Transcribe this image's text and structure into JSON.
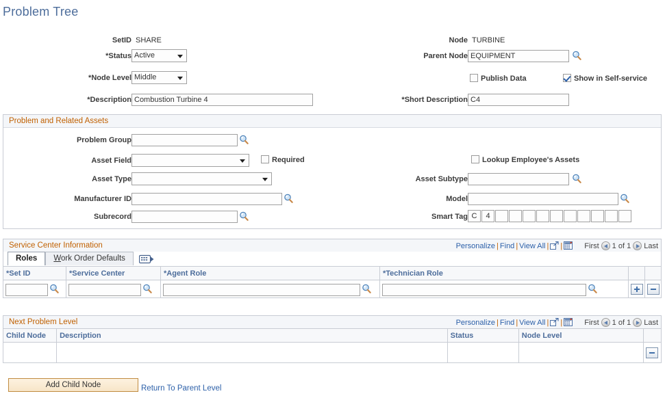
{
  "page": {
    "title": "Problem Tree"
  },
  "header_left": {
    "setid_label": "SetID",
    "setid_value": "SHARE",
    "status_label": "Status",
    "status_value": "Active",
    "node_level_label": "Node Level",
    "node_level_value": "Middle",
    "description_label": "Description",
    "description_value": "Combustion Turbine 4"
  },
  "header_right": {
    "node_label": "Node",
    "node_value": "TURBINE",
    "parent_node_label": "Parent Node",
    "parent_node_value": "EQUIPMENT",
    "publish_data_label": "Publish Data",
    "publish_data_checked": false,
    "show_self_service_label": "Show in Self-service",
    "show_self_service_checked": true,
    "short_description_label": "Short Description",
    "short_description_value": "C4"
  },
  "assets_section": {
    "title": "Problem and Related Assets",
    "problem_group_label": "Problem Group",
    "problem_group_value": "",
    "asset_field_label": "Asset Field",
    "asset_field_value": "",
    "required_label": "Required",
    "required_checked": false,
    "asset_type_label": "Asset Type",
    "asset_type_value": "",
    "manufacturer_id_label": "Manufacturer ID",
    "manufacturer_id_value": "",
    "subrecord_label": "Subrecord",
    "subrecord_value": "",
    "lookup_employee_assets_label": "Lookup Employee's Assets",
    "lookup_employee_assets_checked": false,
    "asset_subtype_label": "Asset Subtype",
    "asset_subtype_value": "",
    "model_label": "Model",
    "model_value": "",
    "smart_tag_label": "Smart Tag",
    "smart_tag_boxes": [
      "C",
      "4",
      "",
      "",
      "",
      "",
      "",
      "",
      "",
      "",
      "",
      ""
    ]
  },
  "service_center": {
    "title": "Service Center Information",
    "toolbar": {
      "personalize": "Personalize",
      "find": "Find",
      "view_all": "View All",
      "expand_icon": "new-window-icon",
      "download_icon": "download-grid-icon",
      "first": "First",
      "page_indicator": "1 of 1",
      "last": "Last"
    },
    "tabs": [
      {
        "label": "Roles",
        "active": true
      },
      {
        "label": "Work Order Defaults",
        "active": false
      }
    ],
    "tab_icon": "show-all-columns-icon",
    "columns": [
      "Set ID",
      "Service Center",
      "Agent Role",
      "Technician Role"
    ],
    "rows": [
      {
        "set_id": "",
        "service_center": "",
        "agent_role": "",
        "technician_role": ""
      }
    ],
    "add_row_button": "add-row-button",
    "delete_row_button": "delete-row-button"
  },
  "next_problem_level": {
    "title": "Next Problem Level",
    "toolbar": {
      "personalize": "Personalize",
      "find": "Find",
      "view_all": "View All",
      "expand_icon": "new-window-icon",
      "download_icon": "download-grid-icon",
      "first": "First",
      "page_indicator": "1 of 1",
      "last": "Last"
    },
    "columns": [
      "Child Node",
      "Description",
      "Status",
      "Node Level"
    ],
    "rows": [
      {
        "child_node": "",
        "description": "",
        "status": "",
        "node_level": ""
      }
    ],
    "delete_row_button": "delete-row-button"
  },
  "footer": {
    "add_child_node": "Add Child Node",
    "return_to_parent": "Return To Parent Level"
  },
  "colors": {
    "title": "#4d6d9b",
    "section_header_text": "#c06000",
    "link": "#2b5fa8",
    "column_header_text": "#4d6d9b",
    "button_border": "#c08b40"
  }
}
